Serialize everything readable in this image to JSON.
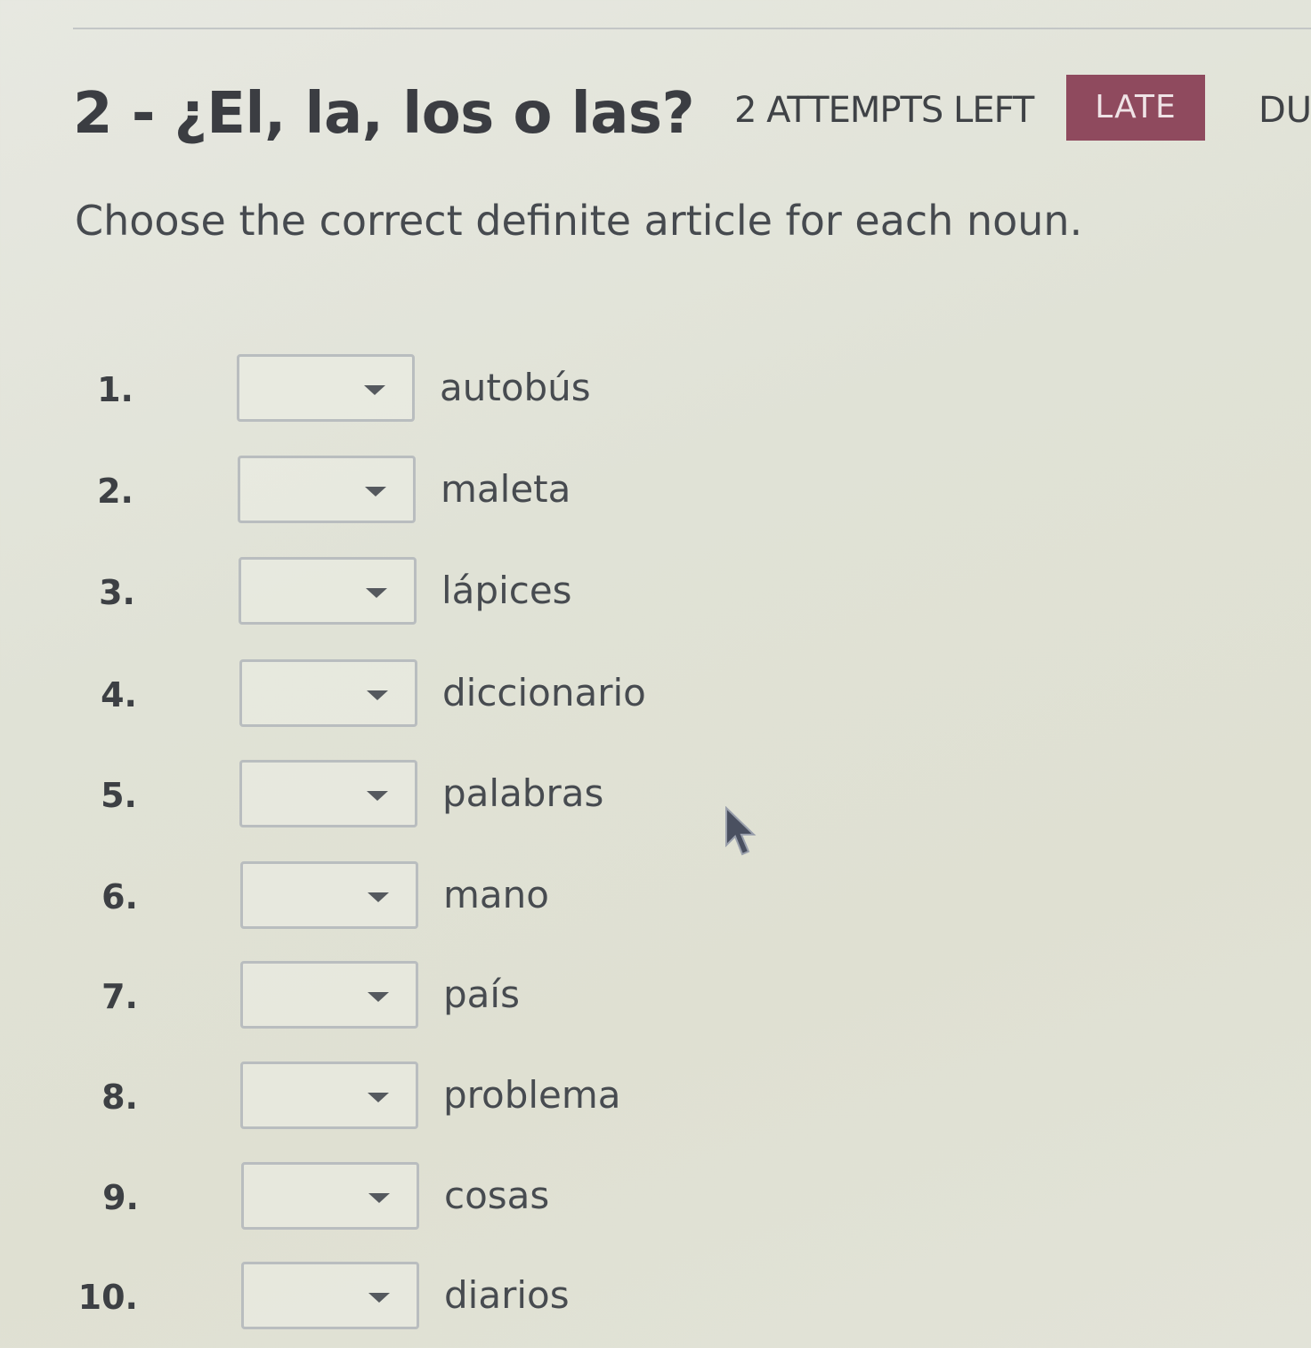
{
  "header": {
    "title": "2 - ¿El, la, los o las?",
    "attempts": "2 ATTEMPTS LEFT",
    "late_badge": "LATE",
    "due_label": "DU"
  },
  "instructions": "Choose the correct definite article for each noun.",
  "items": [
    {
      "number": "1.",
      "noun": "autobús",
      "selected": ""
    },
    {
      "number": "2.",
      "noun": "maleta",
      "selected": ""
    },
    {
      "number": "3.",
      "noun": "lápices",
      "selected": ""
    },
    {
      "number": "4.",
      "noun": "diccionario",
      "selected": ""
    },
    {
      "number": "5.",
      "noun": "palabras",
      "selected": ""
    },
    {
      "number": "6.",
      "noun": "mano",
      "selected": ""
    },
    {
      "number": "7.",
      "noun": "país",
      "selected": ""
    },
    {
      "number": "8.",
      "noun": "problema",
      "selected": ""
    },
    {
      "number": "9.",
      "noun": "cosas",
      "selected": ""
    },
    {
      "number": "10.",
      "noun": "diarios",
      "selected": ""
    }
  ],
  "colors": {
    "late_badge_bg": "#8f4a5e",
    "text": "#3b3d42",
    "select_border": "#b9bdbf"
  },
  "icons": {
    "select_caret": "chevron-down-icon",
    "cursor": "mouse-pointer-icon"
  }
}
